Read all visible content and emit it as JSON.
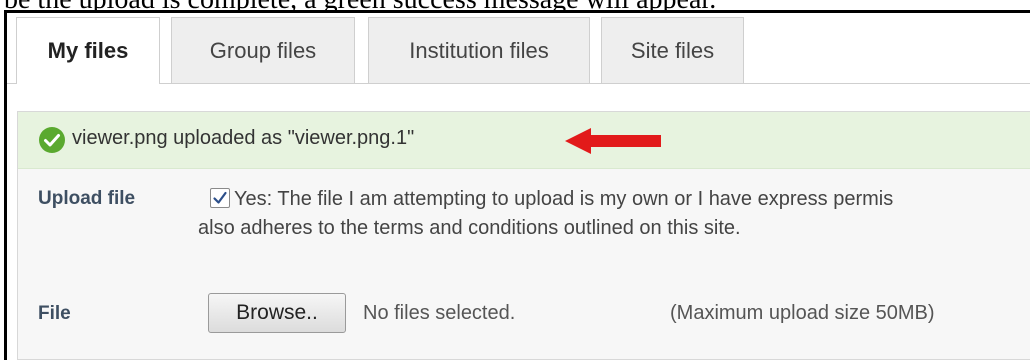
{
  "caption": "be the upload is complete, a green success message will appear.",
  "tabs": [
    {
      "label": "My files",
      "active": true
    },
    {
      "label": "Group files",
      "active": false
    },
    {
      "label": "Institution files",
      "active": false
    },
    {
      "label": "Site files",
      "active": false
    }
  ],
  "success": {
    "icon": "check-circle-icon",
    "message": "viewer.png uploaded as \"viewer.png.1\"",
    "color": "#e7f3df"
  },
  "annotation": {
    "icon": "arrow-left-icon",
    "color": "#e21a1a"
  },
  "upload": {
    "label": "Upload file",
    "checkbox_checked": true,
    "permission_line1": "Yes: The file I am attempting to upload is my own or I have express permis",
    "permission_line2": "also adheres to the terms and conditions outlined on this site."
  },
  "file": {
    "label": "File",
    "browse_label": "Browse..",
    "status": "No files selected.",
    "max_size": "(Maximum upload size 50MB)"
  }
}
